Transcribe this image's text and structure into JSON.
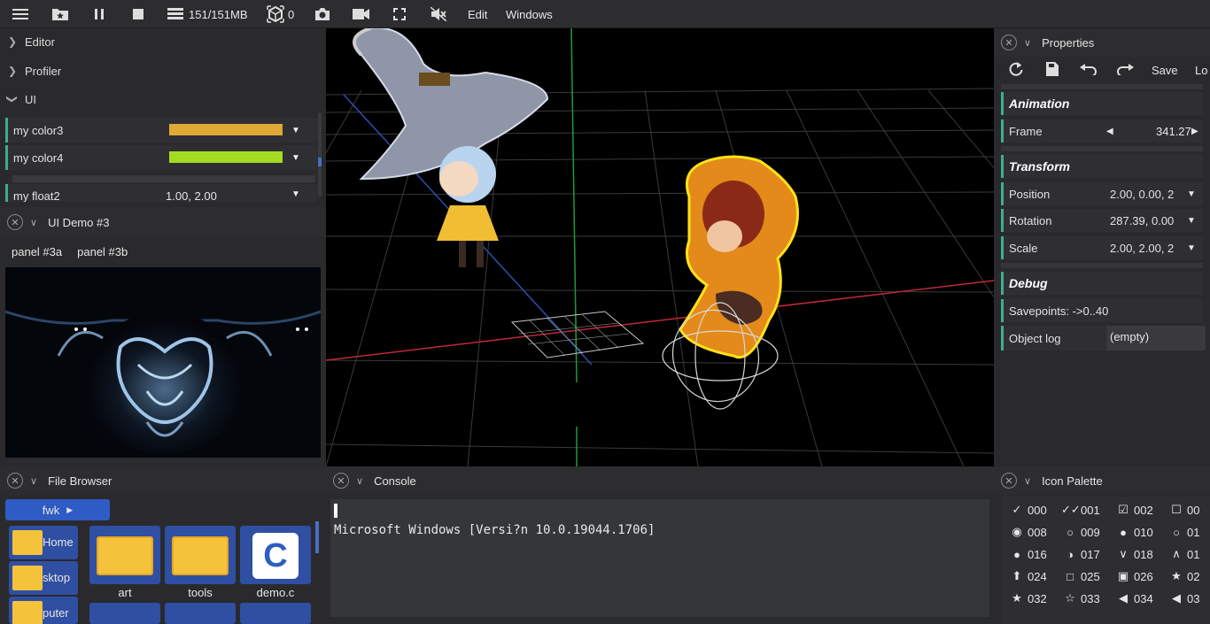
{
  "menubar": {
    "memory": "151/151MB",
    "objects_count": "0",
    "edit": "Edit",
    "windows": "Windows"
  },
  "left_tree": {
    "editor": "Editor",
    "profiler": "Profiler",
    "ui": "UI",
    "items": [
      {
        "label": "my color3",
        "color": "#e0a936"
      },
      {
        "label": "my color4",
        "color": "#a4dc22"
      },
      {
        "label": "my float2",
        "value": "1.00, 2.00"
      }
    ]
  },
  "ui_demo": {
    "title": "UI Demo #3",
    "tabs": [
      "panel #3a",
      "panel #3b"
    ]
  },
  "properties": {
    "title": "Properties",
    "toolbar": {
      "save": "Save",
      "load": "Lo"
    },
    "sections": {
      "animation": "Animation",
      "transform": "Transform",
      "debug": "Debug"
    },
    "frame": {
      "label": "Frame",
      "value": "341.27"
    },
    "position": {
      "label": "Position",
      "value": "2.00, 0.00, 2"
    },
    "rotation": {
      "label": "Rotation",
      "value": "287.39, 0.00"
    },
    "scale": {
      "label": "Scale",
      "value": "2.00, 2.00, 2"
    },
    "savepoints": "Savepoints: ->0..40",
    "object_log": {
      "label": "Object log",
      "value": "(empty)"
    }
  },
  "file_browser": {
    "title": "File Browser",
    "path": "fwk",
    "places": [
      "Home",
      "sktop",
      "puter"
    ],
    "files": [
      "art",
      "tools",
      "demo.c"
    ]
  },
  "console": {
    "title": "Console",
    "line": "Microsoft Windows [Versi?n 10.0.19044.1706]"
  },
  "icon_palette": {
    "title": "Icon Palette",
    "items": [
      [
        "000",
        "001",
        "002",
        "00"
      ],
      [
        "008",
        "009",
        "010",
        "01"
      ],
      [
        "016",
        "017",
        "018",
        "01"
      ],
      [
        "024",
        "025",
        "026",
        "02"
      ],
      [
        "032",
        "033",
        "034",
        "03"
      ]
    ]
  }
}
